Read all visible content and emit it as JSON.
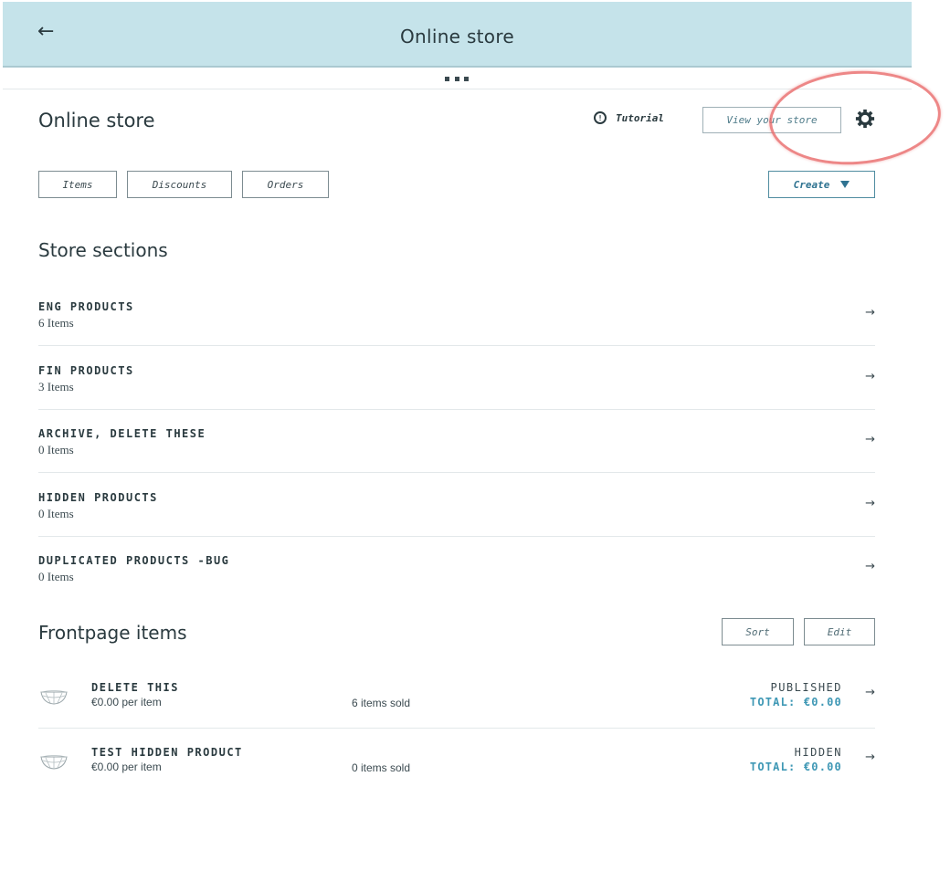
{
  "topbar": {
    "back_icon": "arrow-left-icon",
    "back_glyph": "←",
    "title": "Online store"
  },
  "header": {
    "title": "Online store",
    "tutorial_label": "Tutorial",
    "tutorial_icon_glyph": "!",
    "view_store_label": "View your store",
    "settings_icon": "gear-icon"
  },
  "tabs": {
    "items": "Items",
    "discounts": "Discounts",
    "orders": "Orders"
  },
  "create": {
    "label": "Create",
    "icon": "caret-down-icon"
  },
  "store_sections": {
    "heading": "Store sections",
    "arrow_glyph": "→",
    "rows": [
      {
        "name": "ENG PRODUCTS",
        "count": "6 Items"
      },
      {
        "name": "FIN PRODUCTS",
        "count": "3 Items"
      },
      {
        "name": "ARCHIVE, DELETE THESE",
        "count": "0 Items"
      },
      {
        "name": "HIDDEN PRODUCTS",
        "count": "0 Items"
      },
      {
        "name": "DUPLICATED PRODUCTS -BUG",
        "count": "0 Items"
      }
    ]
  },
  "frontpage": {
    "heading": "Frontpage items",
    "sort_label": "Sort",
    "edit_label": "Edit",
    "items": [
      {
        "name": "DELETE THIS",
        "price": "€0.00 per item",
        "sold": "6 items sold",
        "status": "PUBLISHED",
        "total": "TOTAL: €0.00"
      },
      {
        "name": "TEST HIDDEN PRODUCT",
        "price": "€0.00 per item",
        "sold": "0 items sold",
        "status": "HIDDEN",
        "total": "TOTAL: €0.00"
      }
    ]
  },
  "colors": {
    "topbar_bg": "#c5e3ea",
    "accent": "#2f7391",
    "total_text": "#3f98b5",
    "annotation_ring": "#e96a6a"
  }
}
